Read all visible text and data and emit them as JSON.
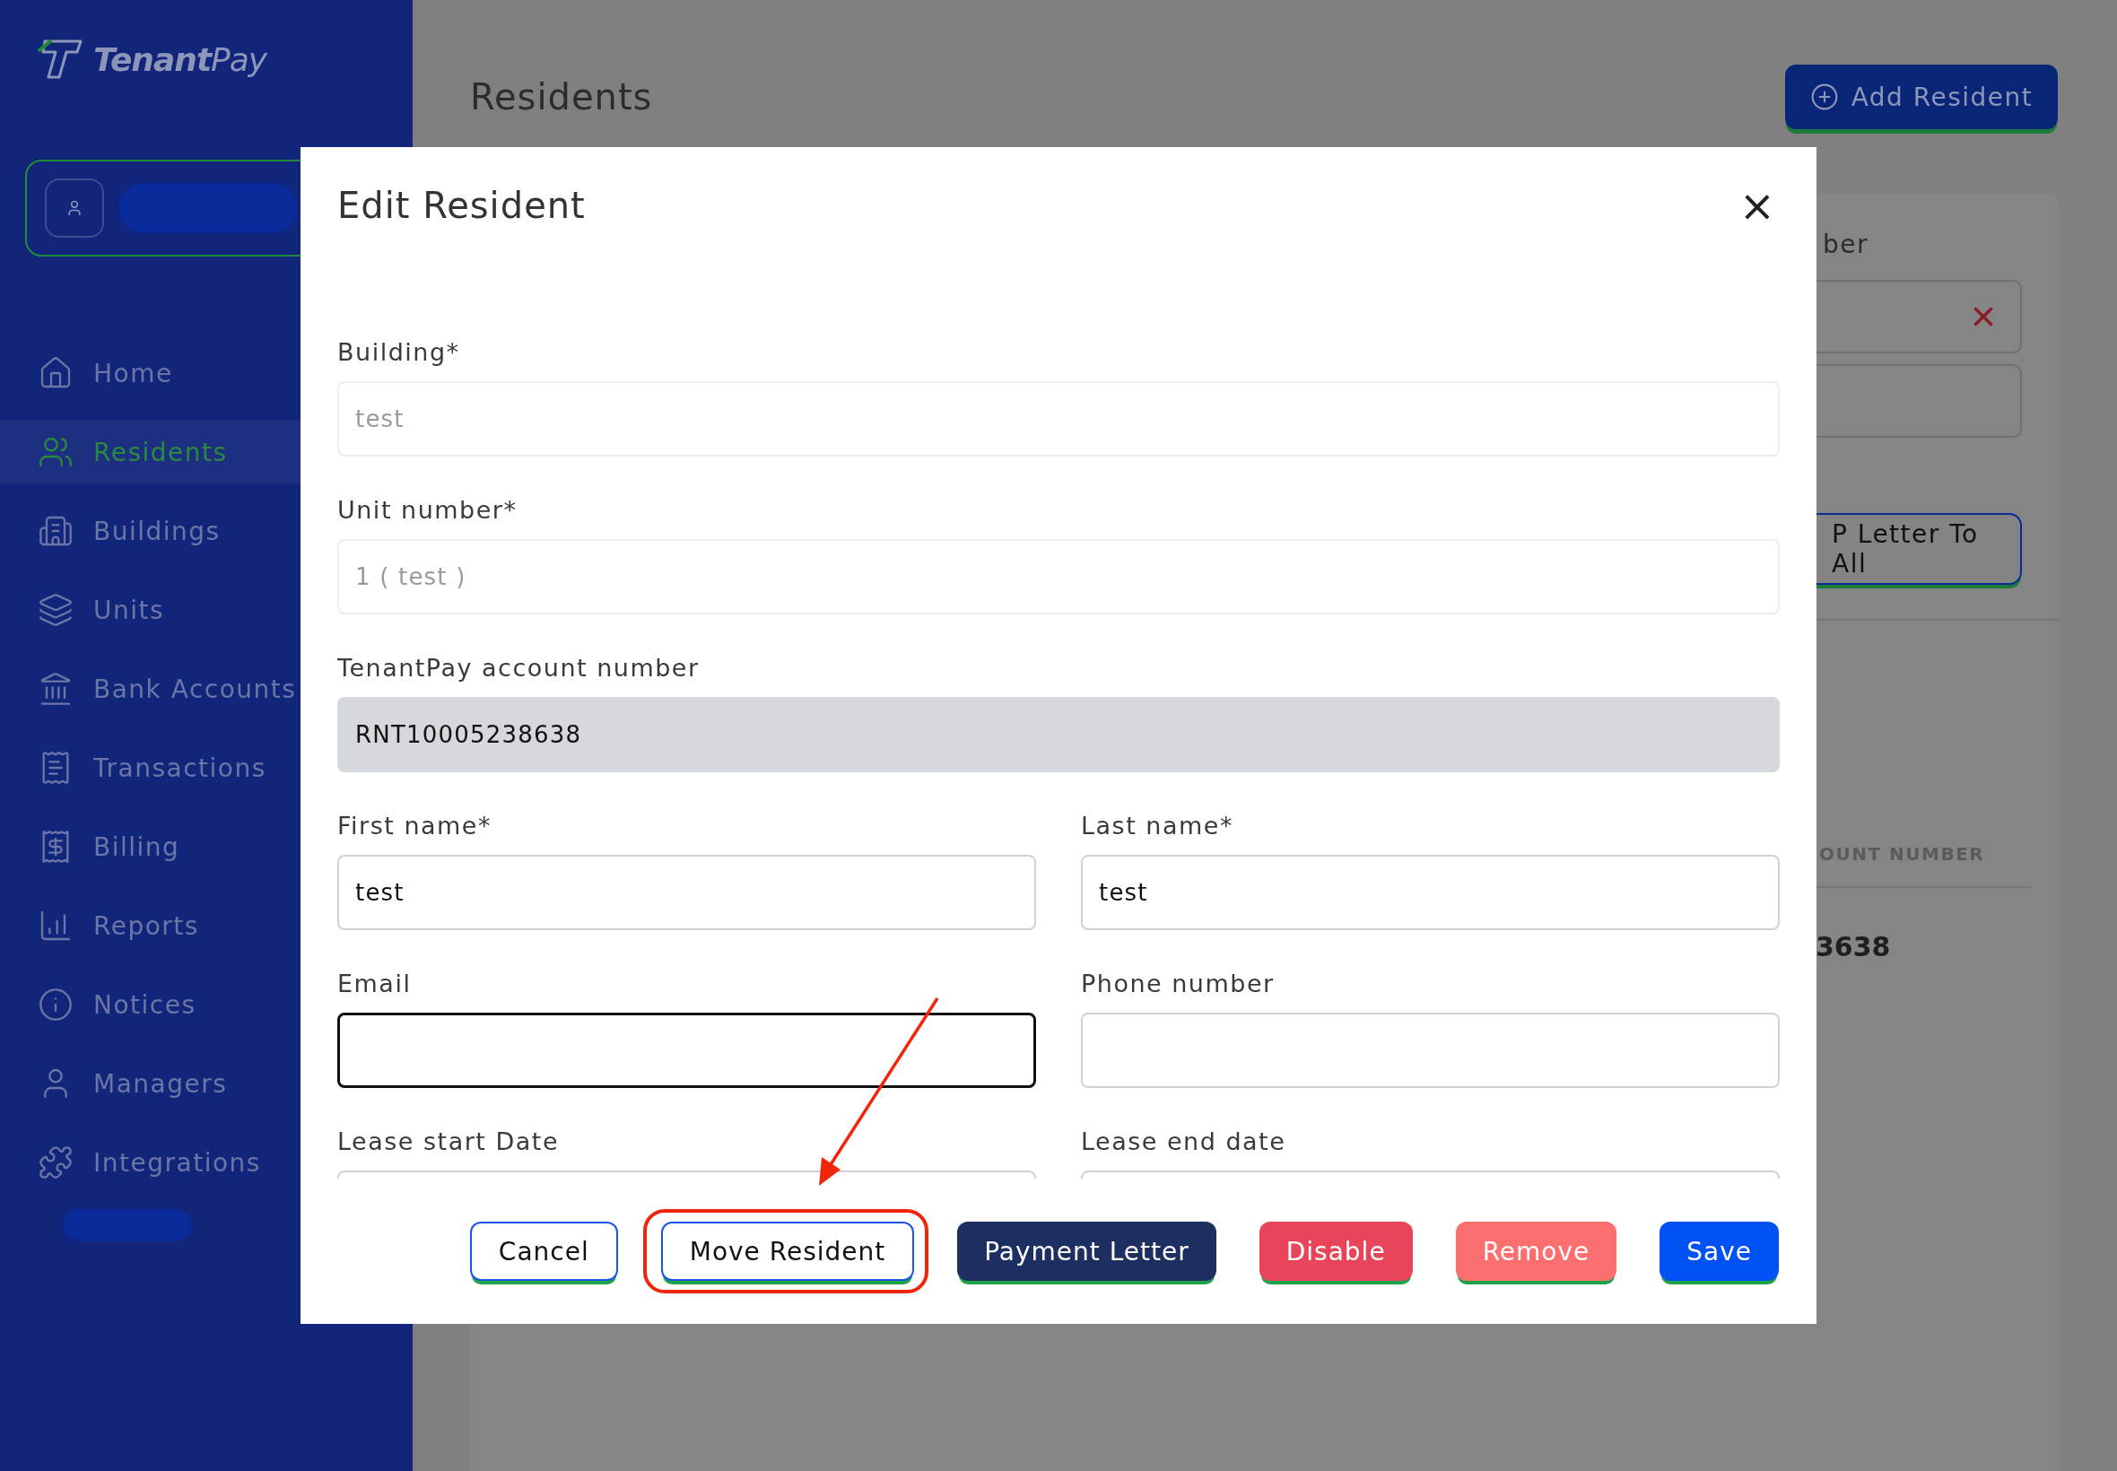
{
  "brand": {
    "name_bold": "Tenant",
    "name_light": "Pay"
  },
  "sidebar": {
    "items": [
      {
        "label": "Home",
        "selected": false
      },
      {
        "label": "Residents",
        "selected": true
      },
      {
        "label": "Buildings",
        "selected": false
      },
      {
        "label": "Units",
        "selected": false
      },
      {
        "label": "Bank Accounts",
        "selected": false
      },
      {
        "label": "Transactions",
        "selected": false
      },
      {
        "label": "Billing",
        "selected": false
      },
      {
        "label": "Reports",
        "selected": false
      },
      {
        "label": "Notices",
        "selected": false
      },
      {
        "label": "Managers",
        "selected": false
      },
      {
        "label": "Integrations",
        "selected": false
      }
    ]
  },
  "page": {
    "title": "Residents",
    "add_button": "Add Resident",
    "filter_label": "ber",
    "column_header": "OUNT NUMBER",
    "cell": "3638",
    "letter_button": "P Letter To All"
  },
  "dialog": {
    "title": "Edit Resident",
    "close": "×",
    "rows": [
      [
        {
          "label": "Building*",
          "value": "test",
          "kind": "select",
          "disabled": true,
          "focused": false
        }
      ],
      [
        {
          "label": "Unit number*",
          "value": "1 ( test )",
          "kind": "select",
          "disabled": true,
          "focused": false
        }
      ],
      [
        {
          "label": "TenantPay account number",
          "value": "RNT10005238638",
          "kind": "readonly",
          "disabled": false,
          "focused": false
        }
      ],
      [
        {
          "label": "First name*",
          "value": "test",
          "kind": "text",
          "disabled": false,
          "focused": false
        },
        {
          "label": "Last name*",
          "value": "test",
          "kind": "text",
          "disabled": false,
          "focused": false
        }
      ],
      [
        {
          "label": "Email",
          "kind": "text",
          "disabled": false,
          "focused": true
        },
        {
          "label": "Phone number",
          "kind": "text",
          "disabled": false,
          "focused": false
        }
      ],
      [
        {
          "label": "Lease start Date",
          "kind": "date",
          "disabled": false,
          "focused": false
        },
        {
          "label": "Lease end date",
          "kind": "date",
          "disabled": false,
          "focused": false
        }
      ]
    ],
    "buttons": [
      {
        "label": "Cancel",
        "kind": "outline",
        "highlighted": false
      },
      {
        "label": "Move Resident",
        "kind": "outline",
        "highlighted": true
      },
      {
        "label": "Payment Letter",
        "kind": "navy",
        "highlighted": false
      },
      {
        "label": "Disable",
        "kind": "danger",
        "highlighted": false
      },
      {
        "label": "Remove",
        "kind": "warning",
        "highlighted": false
      },
      {
        "label": "Save",
        "kind": "primary",
        "highlighted": false
      }
    ]
  }
}
